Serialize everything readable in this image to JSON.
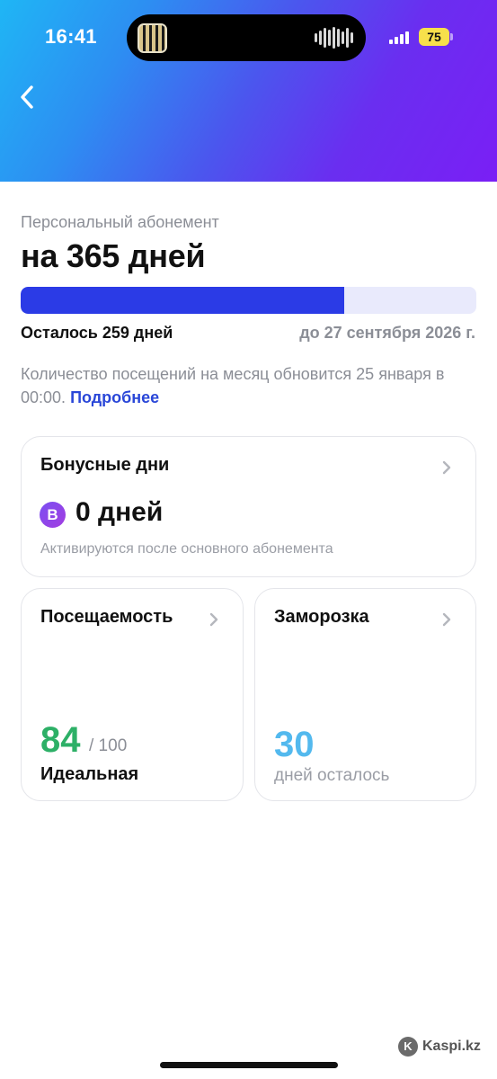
{
  "status_bar": {
    "time": "16:41",
    "battery": "75",
    "battery_color": "#f7e04b"
  },
  "header": {
    "back_icon": "chevron-left-icon",
    "gradient": [
      "#1fb6f5",
      "#4b56ee",
      "#7a1ff5"
    ]
  },
  "membership": {
    "subtitle": "Персональный абонемент",
    "title": "на 365 дней",
    "progress_fraction": 0.71,
    "remaining": "Осталось 259 дней",
    "until": "до 27 сентября 2026 г.",
    "info_text": "Количество посещений на месяц обновится 25 января в 00:00.",
    "info_link": "Подробнее"
  },
  "bonus_card": {
    "title": "Бонусные дни",
    "icon_letter": "B",
    "value": "0 дней",
    "note": "Активируются после основного абонемента"
  },
  "attendance_card": {
    "title": "Посещаемость",
    "score": "84",
    "max": "/ 100",
    "label": "Идеальная"
  },
  "freeze_card": {
    "title": "Заморозка",
    "value": "30",
    "label": "дней осталось"
  },
  "watermark": {
    "text": "Kaspi.kz"
  },
  "colors": {
    "accent": "#2b3be6",
    "link": "#2a47d8",
    "score_green": "#2db067",
    "freeze_blue": "#53b9ee"
  }
}
